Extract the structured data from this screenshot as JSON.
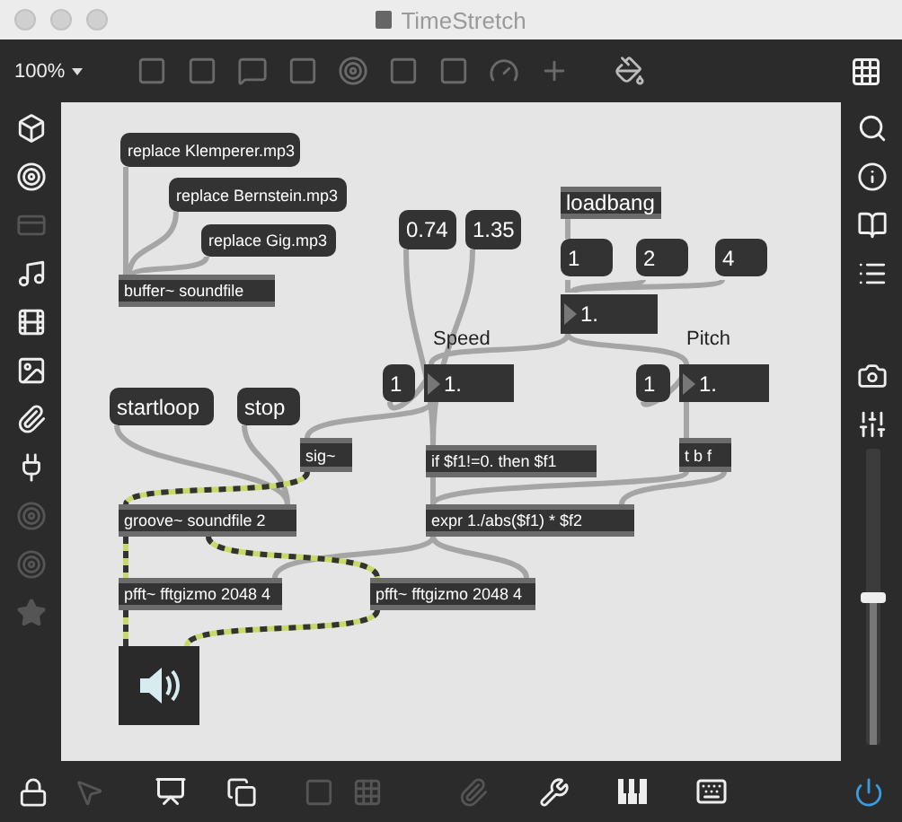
{
  "window": {
    "title": "TimeStretch"
  },
  "toolbar": {
    "zoom": "100%"
  },
  "patch": {
    "boxes": [
      {
        "kind": "message",
        "text": "replace Klemperer.mp3"
      },
      {
        "kind": "message",
        "text": "replace Bernstein.mp3"
      },
      {
        "kind": "message",
        "text": "replace Gig.mp3"
      },
      {
        "kind": "object",
        "text": "buffer~ soundfile"
      },
      {
        "kind": "message",
        "text": "0.74"
      },
      {
        "kind": "message",
        "text": "1.35"
      },
      {
        "kind": "object",
        "text": "loadbang"
      },
      {
        "kind": "message",
        "text": "1"
      },
      {
        "kind": "message",
        "text": "2"
      },
      {
        "kind": "message",
        "text": "4"
      },
      {
        "kind": "number",
        "text": "1."
      },
      {
        "kind": "comment",
        "text": "Speed"
      },
      {
        "kind": "comment",
        "text": "Pitch"
      },
      {
        "kind": "message",
        "text": "1"
      },
      {
        "kind": "number",
        "text": "1."
      },
      {
        "kind": "message",
        "text": "1"
      },
      {
        "kind": "number",
        "text": "1."
      },
      {
        "kind": "message",
        "text": "startloop"
      },
      {
        "kind": "message",
        "text": "stop"
      },
      {
        "kind": "object",
        "text": "sig~"
      },
      {
        "kind": "object",
        "text": "if $f1!=0. then $f1"
      },
      {
        "kind": "object",
        "text": "t b f"
      },
      {
        "kind": "object",
        "text": "groove~ soundfile 2"
      },
      {
        "kind": "object",
        "text": "expr 1./abs($f1) * $f2"
      },
      {
        "kind": "object",
        "text": "pfft~ fftgizmo 2048 4"
      },
      {
        "kind": "object",
        "text": "pfft~ fftgizmo 2048 4"
      },
      {
        "kind": "dac"
      }
    ]
  },
  "gain_slider": {
    "level": 0.5
  }
}
